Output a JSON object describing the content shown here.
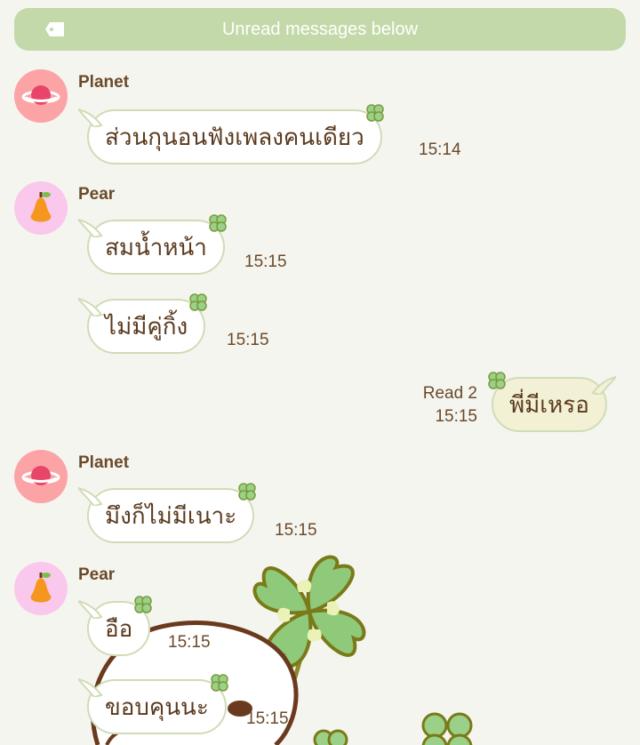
{
  "banner": {
    "label": "Unread messages below",
    "icon": "tag-icon"
  },
  "colors": {
    "background": "#f5f5f0",
    "banner": "#c3d9a9",
    "bubble_border": "#cfdcb6",
    "text": "#6b4a2a",
    "own_bubble": "#f2f1d6"
  },
  "messages": [
    {
      "sender": "Planet",
      "text": "ส่วนกุนอนฟังเพลงคนเดียว",
      "time": "15:14"
    },
    {
      "sender": "Pear",
      "text": "สมน้ำหน้า",
      "time": "15:15"
    },
    {
      "sender": "Pear",
      "text": "ไม่มีคู่กิ้ง",
      "time": "15:15"
    },
    {
      "sender": "me",
      "text": "พี่มีเหรอ",
      "time": "15:15",
      "read": "Read 2"
    },
    {
      "sender": "Planet",
      "text": "มึงก็ไม่มีเนาะ",
      "time": "15:15"
    },
    {
      "sender": "Pear",
      "text": "อือ",
      "time": "15:15"
    },
    {
      "sender": "Pear",
      "text": "ขอบคุนนะ",
      "time": "15:15"
    }
  ]
}
